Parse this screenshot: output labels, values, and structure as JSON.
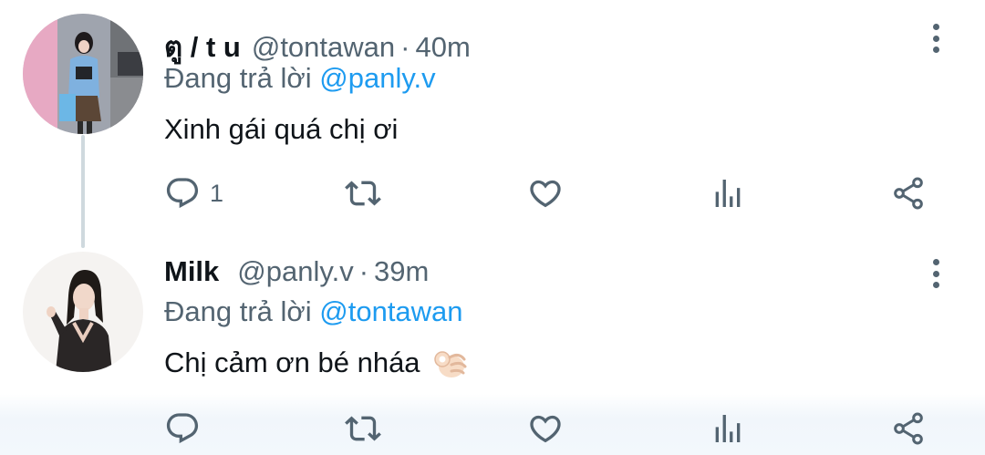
{
  "tweets": [
    {
      "display_name": "ตู / t u",
      "handle": "@tontawan",
      "separator": "·",
      "time": "40m",
      "replying_prefix": "Đang trả lời",
      "replying_to": "@panly.v",
      "text": "Xinh gái quá chị ơi",
      "reply_count": "1",
      "has_emoji": false
    },
    {
      "display_name": "Milk",
      "handle": "@panly.v",
      "separator": "·",
      "time": "39m",
      "replying_prefix": "Đang trả lời",
      "replying_to": "@tontawan",
      "text": "Chị cảm ơn bé nháa",
      "reply_count": "",
      "has_emoji": true,
      "emoji_name": "ok-hand-emoji"
    }
  ],
  "icons": [
    "reply-icon",
    "retweet-icon",
    "like-icon",
    "analytics-icon",
    "share-icon",
    "more-options-icon"
  ],
  "colors": {
    "link": "#1d9bf0",
    "secondary_text": "#536471",
    "primary_text": "#0f1419",
    "thread_line": "#cfd9de"
  }
}
